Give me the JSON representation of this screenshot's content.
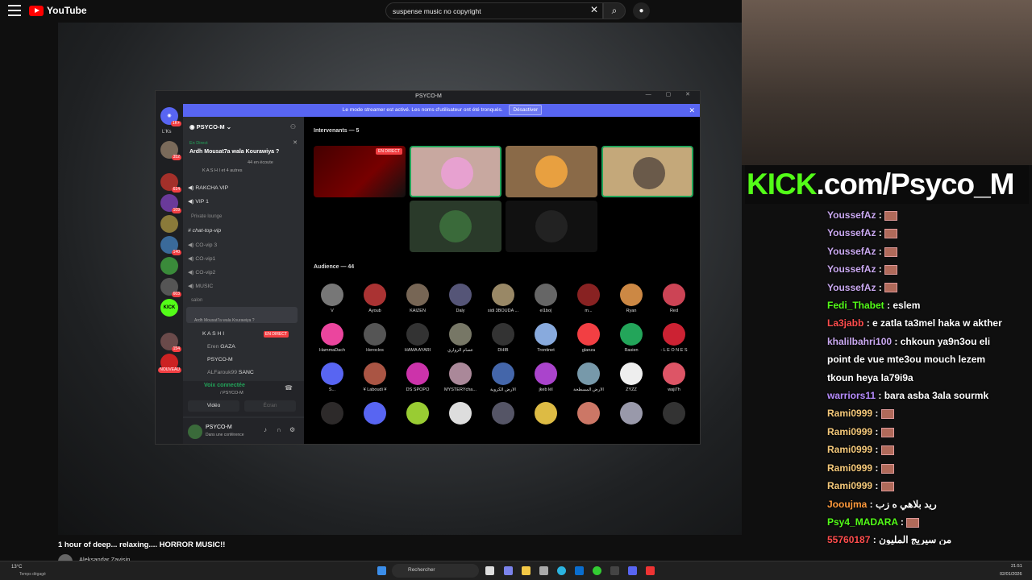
{
  "youtube": {
    "logo": "YouTube",
    "search_value": "suspense music no copyright",
    "video_title": "1 hour of deep... relaxing.... HORROR MUSIC!!",
    "channel": "Aleksandar Zavisin"
  },
  "discord": {
    "window_title": "PSYCO-M",
    "banner_text": "Le mode streamer est activé. Les noms d'utilisateur ont été tronqués.",
    "banner_button": "Désactiver",
    "server_name": "PSYCO-M",
    "live_label": "En Direct",
    "stage_title": "Ardh Mousat7a wala Kourawiya ?",
    "listeners": "44 en écoute",
    "host_line": "K A S H I et 4 autres",
    "channels": [
      "RAKCHA VIP",
      "VIP 1"
    ],
    "private_category": "Private lounge",
    "private_channels": [
      "chat-top-vip",
      "CO-vip 3",
      "CO-vip1",
      "CO-vip2",
      "MUSIC"
    ],
    "salon_category": "salon",
    "stage_channel_sub": "Ardh Mousat7a wala Kourawiya ?",
    "stage_users": [
      "K A S H I",
      "Eren",
      "PSYCO-M",
      "ALFarouk99"
    ],
    "stage_users_tags": [
      "EN DIRECT",
      "GAZA",
      "",
      "SANC"
    ],
    "voice_connected": "Voix connectée",
    "voice_sub": "/ PSYCO-M",
    "video_btn": "Vidéo",
    "screen_btn": "Écran",
    "me_name": "PSYCO-M",
    "me_status": "Dans une conférence",
    "guild_label": "L'Ks",
    "guild_badges": [
      "1K+",
      "352",
      "614",
      "109",
      "140",
      "603",
      "154",
      "NOUVEAU"
    ],
    "speakers_header": "Intervenants — 5",
    "live_badge": "EN DIRECT",
    "audience_header": "Audience — 44",
    "audience": [
      "V",
      "Ayoub",
      "KAIZEN",
      "Daly",
      "sidi 3BOUDA ...",
      "el1bo|",
      "m...",
      "Ryan",
      "Red",
      "HammaDach",
      "Heroclos",
      "HAMA AYARI",
      "عصام الزواري",
      "DHIB",
      "Trontinet",
      "glanza",
      "Rasien",
      "- L E O N E S",
      "S...",
      "¥ Laboudi ¥",
      "DS SPOPO",
      "MYSTERYcha...",
      "الأرض الكروية",
      "jkeb lél",
      "الأرض المسطحة",
      "ZYZZ",
      "waji7h",
      "",
      "",
      "",
      "",
      "",
      "",
      "",
      "",
      ""
    ],
    "audience_colors": [
      "#777",
      "#a33",
      "#765",
      "#557",
      "#986",
      "#666",
      "#822",
      "#c84",
      "#c45",
      "#eb459e",
      "#555",
      "#333",
      "#776",
      "#333",
      "#8ad",
      "#f23f43",
      "#23a55a",
      "#c23",
      "#5865f2",
      "#a54",
      "#c3a",
      "#a89",
      "#46a",
      "#a4c",
      "#79a",
      "#eee",
      "#d56",
      "#2d2a2a",
      "#5865f2",
      "#9c3",
      "#ddd",
      "#556",
      "#db4",
      "#c76",
      "#99a",
      "#333"
    ]
  },
  "kick": {
    "prefix": "KICK",
    "suffix": ".com/Psyco_M"
  },
  "chat": [
    {
      "user": "YoussefAz",
      "color": "#c9a8f0",
      "text": "",
      "emote": true
    },
    {
      "user": "YoussefAz",
      "color": "#c9a8f0",
      "text": "",
      "emote": true
    },
    {
      "user": "YoussefAz",
      "color": "#c9a8f0",
      "text": "",
      "emote": true
    },
    {
      "user": "YoussefAz",
      "color": "#c9a8f0",
      "text": "",
      "emote": true
    },
    {
      "user": "YoussefAz",
      "color": "#c9a8f0",
      "text": "",
      "emote": true
    },
    {
      "user": "Fedi_Thabet",
      "color": "#53fc18",
      "text": "eslem",
      "emote": false
    },
    {
      "user": "La3jabb",
      "color": "#ff4d4d",
      "text": "e zatla ta3mel haka w akther",
      "emote": false
    },
    {
      "user": "khalilbahri100",
      "color": "#c9a8f0",
      "text": "chkoun ya9n3ou eli",
      "emote": false
    },
    {
      "user": "",
      "color": "#fff",
      "text": "point de vue mte3ou mouch lezem",
      "emote": false
    },
    {
      "user": "",
      "color": "#fff",
      "text": "tkoun heya la79i9a",
      "emote": false
    },
    {
      "user": "warriors11",
      "color": "#b78cff",
      "text": "bara asba 3ala sourmk",
      "emote": false
    },
    {
      "user": "Rami0999",
      "color": "#f5c97a",
      "text": "",
      "emote": true
    },
    {
      "user": "Rami0999",
      "color": "#f5c97a",
      "text": "",
      "emote": true
    },
    {
      "user": "Rami0999",
      "color": "#f5c97a",
      "text": "",
      "emote": true
    },
    {
      "user": "Rami0999",
      "color": "#f5c97a",
      "text": "",
      "emote": true
    },
    {
      "user": "Rami0999",
      "color": "#f5c97a",
      "text": "",
      "emote": true
    },
    {
      "user": "Jooujma",
      "color": "#ff9a3c",
      "text": "ريد بلاهي ه زب",
      "emote": false
    },
    {
      "user": "Psy4_MADARA",
      "color": "#53fc18",
      "text": "",
      "emote": true
    },
    {
      "user": "55760187",
      "color": "#ff4d4d",
      "text": "من سيريج المليون",
      "emote": false
    }
  ],
  "taskbar": {
    "weather_temp": "13°C",
    "weather_desc": "Temps dégagé",
    "search": "Rechercher",
    "time": "21:51",
    "date": "02/01/2026"
  }
}
